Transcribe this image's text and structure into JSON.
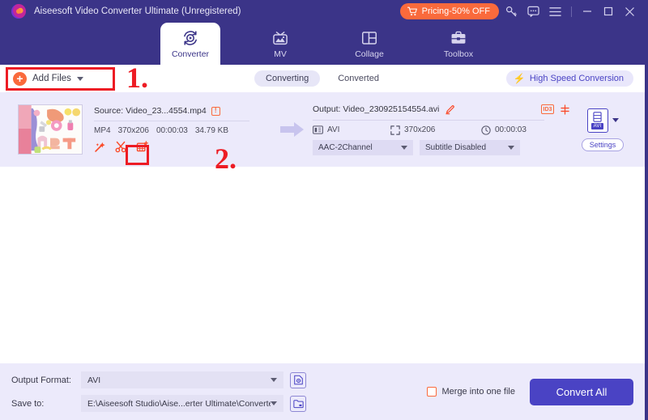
{
  "titlebar": {
    "app_title": "Aiseesoft Video Converter Ultimate (Unregistered)",
    "pricing_label": "Pricing-50% OFF",
    "icons": [
      "cart-icon",
      "key-icon",
      "feedback-icon",
      "menu-icon"
    ],
    "window_controls": [
      "minimize",
      "maximize",
      "close"
    ]
  },
  "nav": {
    "tabs": [
      {
        "label": "Converter",
        "icon": "converter-icon",
        "active": true
      },
      {
        "label": "MV",
        "icon": "mv-icon",
        "active": false
      },
      {
        "label": "Collage",
        "icon": "collage-icon",
        "active": false
      },
      {
        "label": "Toolbox",
        "icon": "toolbox-icon",
        "active": false
      }
    ]
  },
  "toolbar": {
    "add_files_label": "Add Files",
    "segments": [
      {
        "label": "Converting",
        "active": true
      },
      {
        "label": "Converted",
        "active": false
      }
    ],
    "high_speed_label": "High Speed Conversion"
  },
  "file_row": {
    "source": {
      "title": "Source: Video_23...4554.mp4",
      "info_glyph": "!",
      "format": "MP4",
      "resolution": "370x206",
      "duration": "00:00:03",
      "size": "34.79 KB",
      "edit_icons": [
        "magic-wand-icon",
        "scissors-icon",
        "watermark-icon"
      ]
    },
    "output": {
      "title": "Output: Video_230925154554.avi",
      "edit_icon": "pencil-icon",
      "id_badge": "ID3",
      "merge_icon": "split-icon",
      "format": "AVI",
      "resolution": "370x206",
      "duration": "00:00:03",
      "audio_track": "AAC-2Channel",
      "subtitle_track": "Subtitle Disabled"
    },
    "format_selector": {
      "tag": "AVI",
      "settings_label": "Settings"
    }
  },
  "bottom": {
    "output_format_label": "Output Format:",
    "output_format_value": "AVI",
    "save_to_label": "Save to:",
    "save_to_value": "E:\\Aiseesoft Studio\\Aise...erter Ultimate\\Converted",
    "merge_label": "Merge into one file",
    "convert_all_label": "Convert All"
  },
  "annotations": {
    "step_one": "1.",
    "step_two": "2.",
    "color": "#ed1c24"
  }
}
